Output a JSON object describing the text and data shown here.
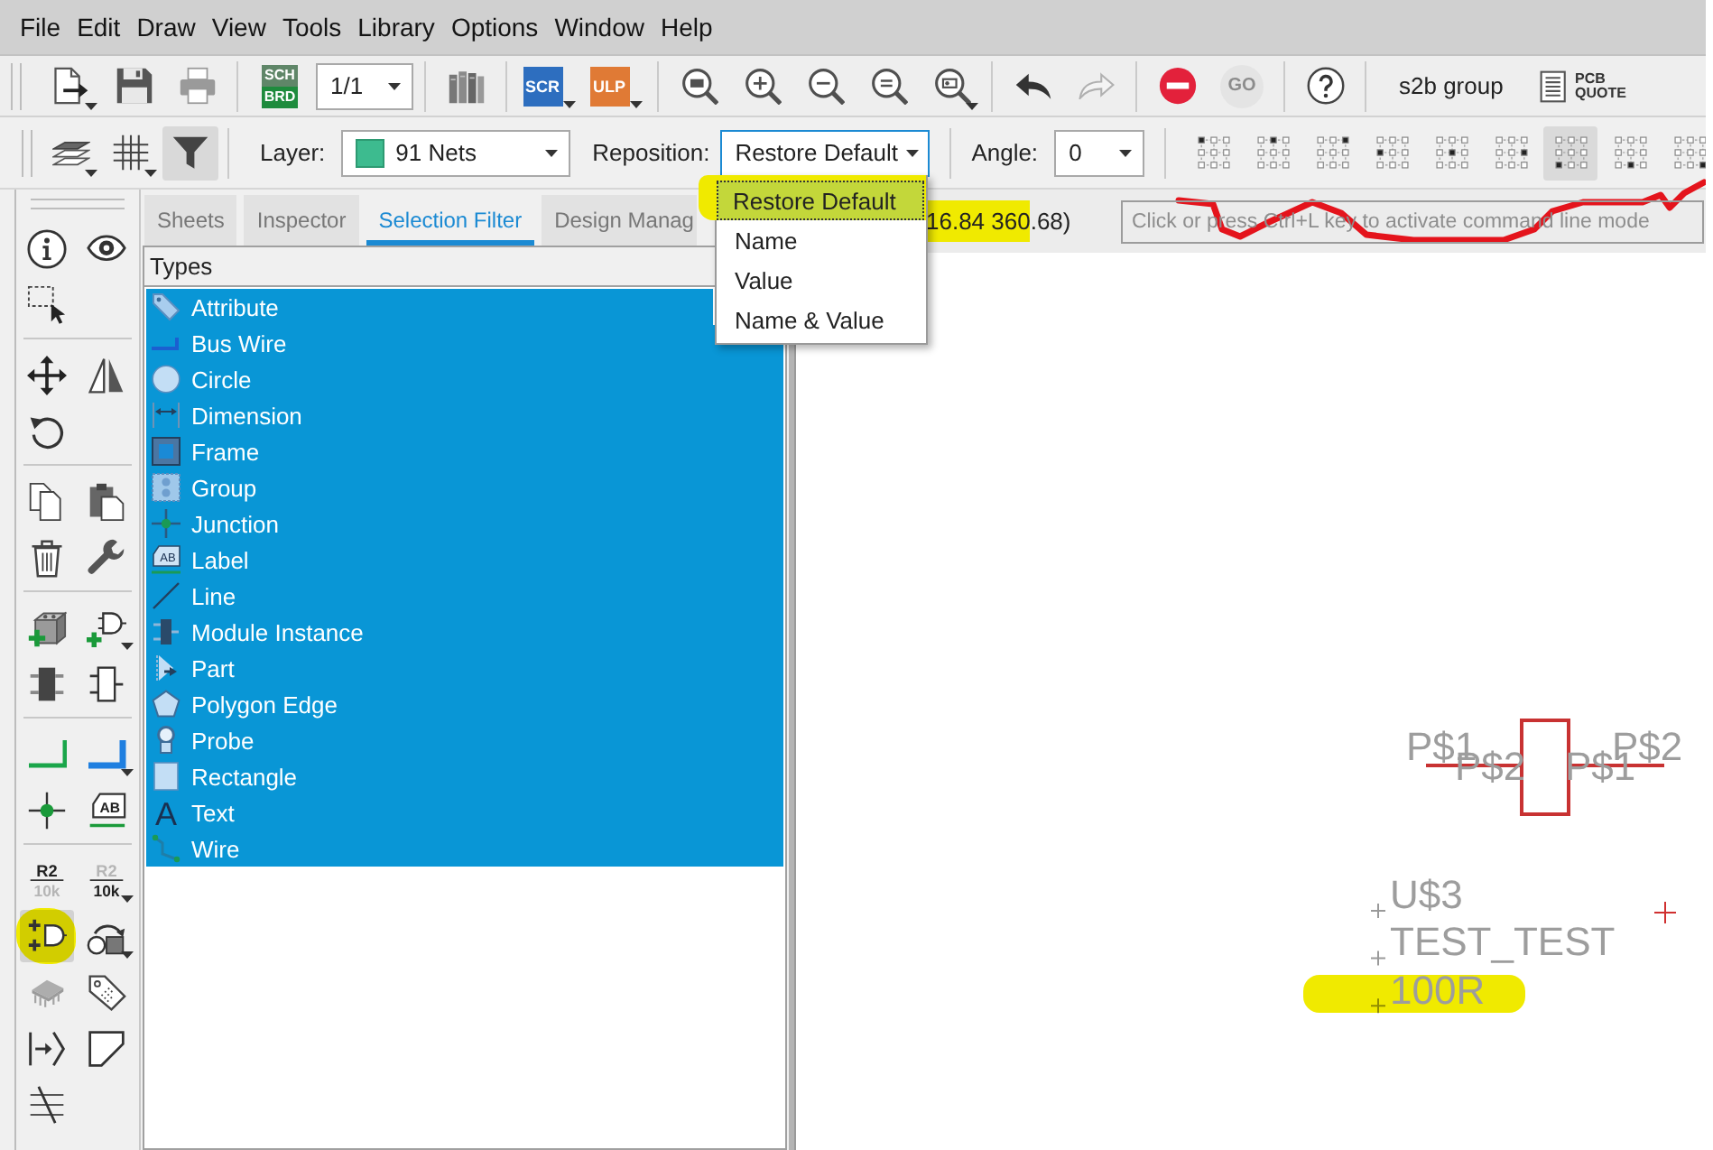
{
  "menu_bar": [
    "File",
    "Edit",
    "Draw",
    "View",
    "Tools",
    "Library",
    "Options",
    "Window",
    "Help"
  ],
  "main_toolbar": [
    [
      {
        "kind": "open-file",
        "disabled": false,
        "dropdown": true
      },
      {
        "kind": "save",
        "disabled": false,
        "dropdown": false
      },
      {
        "kind": "print",
        "disabled": false,
        "dropdown": false
      }
    ],
    [
      {
        "kind": "sch-brd",
        "labels": [
          "SCH",
          "BRD"
        ],
        "disabled": false,
        "dropdown": false
      },
      {
        "kind": "sheet-combo",
        "value": "1/1"
      }
    ],
    [
      {
        "kind": "library",
        "disabled": false,
        "dropdown": false
      }
    ],
    [
      {
        "kind": "script",
        "labels": [
          "SCR"
        ],
        "disabled": false,
        "dropdown": true
      },
      {
        "kind": "ulp",
        "labels": [
          "ULP"
        ],
        "disabled": false,
        "dropdown": true
      }
    ],
    [
      {
        "kind": "zoom-fit",
        "disabled": false,
        "dropdown": false
      },
      {
        "kind": "zoom-in",
        "disabled": false,
        "dropdown": false
      },
      {
        "kind": "zoom-out",
        "disabled": false,
        "dropdown": false
      },
      {
        "kind": "zoom-redraw",
        "disabled": false,
        "dropdown": false
      },
      {
        "kind": "zoom-area",
        "disabled": false,
        "dropdown": true
      }
    ],
    [
      {
        "kind": "undo",
        "disabled": false,
        "dropdown": false
      },
      {
        "kind": "redo",
        "disabled": true,
        "dropdown": false
      }
    ],
    [
      {
        "kind": "stop",
        "disabled": false,
        "dropdown": false
      },
      {
        "kind": "go",
        "labels": [
          "GO"
        ],
        "disabled": true,
        "dropdown": false
      }
    ],
    [
      {
        "kind": "help",
        "disabled": false,
        "dropdown": false
      }
    ],
    [
      {
        "kind": "team",
        "text": "s2b group"
      },
      {
        "kind": "pcb-quote",
        "labels": [
          "PCB",
          "QUOTE"
        ],
        "disabled": false,
        "dropdown": false
      }
    ]
  ],
  "edit_toolbar": {
    "tools": [
      {
        "kind": "layers",
        "selected": false,
        "dropdown": true
      },
      {
        "kind": "grid",
        "selected": false,
        "dropdown": true
      },
      {
        "kind": "filter",
        "selected": true,
        "dropdown": false
      }
    ],
    "layer": {
      "label": "Layer:",
      "value": "91 Nets"
    },
    "reposition": {
      "label": "Reposition:",
      "value": "Restore Default",
      "expanded": true,
      "options": [
        {
          "text": "Restore Default",
          "selected": true,
          "highlighted": true
        },
        {
          "text": "Name",
          "selected": false,
          "highlighted": false
        },
        {
          "text": "Value",
          "selected": false,
          "highlighted": false
        },
        {
          "text": "Name & Value",
          "selected": false,
          "highlighted": false
        }
      ]
    },
    "angle": {
      "label": "Angle:",
      "value": "0"
    },
    "anchors": [
      {
        "kind": "top-left",
        "selected": false
      },
      {
        "kind": "top-center",
        "selected": false
      },
      {
        "kind": "top-right",
        "selected": false
      },
      {
        "kind": "middle-left",
        "selected": false
      },
      {
        "kind": "center",
        "selected": false
      },
      {
        "kind": "middle-right",
        "selected": false
      },
      {
        "kind": "bottom-left",
        "selected": true
      },
      {
        "kind": "bottom-center",
        "selected": false
      },
      {
        "kind": "bottom-right",
        "selected": false
      }
    ]
  },
  "tool_palette": [
    [
      {
        "kind": "info",
        "selected": false,
        "disabled": false,
        "dropdown": false,
        "highlighted": false
      },
      {
        "kind": "show",
        "selected": false,
        "disabled": false,
        "dropdown": false,
        "highlighted": false
      },
      {
        "kind": "group",
        "selected": false,
        "disabled": false,
        "dropdown": false,
        "highlighted": false
      }
    ],
    [
      {
        "kind": "move",
        "selected": false,
        "disabled": false,
        "dropdown": false,
        "highlighted": false
      },
      {
        "kind": "mirror",
        "selected": false,
        "disabled": false,
        "dropdown": false,
        "highlighted": false
      },
      {
        "kind": "rotate",
        "selected": false,
        "disabled": false,
        "dropdown": false,
        "highlighted": false
      }
    ],
    [
      {
        "kind": "copy",
        "selected": false,
        "disabled": false,
        "dropdown": false,
        "highlighted": false
      },
      {
        "kind": "paste",
        "selected": false,
        "disabled": false,
        "dropdown": false,
        "highlighted": false
      },
      {
        "kind": "delete",
        "selected": false,
        "disabled": false,
        "dropdown": false,
        "highlighted": false
      },
      {
        "kind": "change",
        "selected": false,
        "disabled": false,
        "dropdown": false,
        "highlighted": false
      }
    ],
    [
      {
        "kind": "add-part",
        "selected": false,
        "disabled": false,
        "dropdown": false,
        "highlighted": false
      },
      {
        "kind": "add-gate",
        "selected": false,
        "disabled": false,
        "dropdown": true,
        "highlighted": false
      },
      {
        "kind": "module",
        "selected": false,
        "disabled": false,
        "dropdown": false,
        "highlighted": false
      },
      {
        "kind": "port",
        "selected": false,
        "disabled": false,
        "dropdown": false,
        "highlighted": false
      }
    ],
    [
      {
        "kind": "net",
        "selected": false,
        "disabled": false,
        "dropdown": false,
        "highlighted": false
      },
      {
        "kind": "bus",
        "selected": false,
        "disabled": false,
        "dropdown": true,
        "highlighted": false
      },
      {
        "kind": "junction",
        "selected": false,
        "disabled": false,
        "dropdown": false,
        "highlighted": false
      },
      {
        "kind": "label",
        "labels": [
          "AB"
        ],
        "selected": false,
        "disabled": false,
        "dropdown": false,
        "highlighted": false
      }
    ],
    [
      {
        "kind": "name",
        "labels": [
          "R2",
          "10k"
        ],
        "selected": false,
        "disabled": false,
        "dropdown": false,
        "highlighted": false
      },
      {
        "kind": "value",
        "labels": [
          "R2",
          "10k"
        ],
        "selected": false,
        "disabled": false,
        "dropdown": true,
        "highlighted": false
      },
      {
        "kind": "invoke",
        "selected": true,
        "disabled": false,
        "dropdown": false,
        "highlighted": true
      },
      {
        "kind": "replace",
        "selected": false,
        "disabled": false,
        "dropdown": true,
        "highlighted": false
      },
      {
        "kind": "package",
        "selected": false,
        "disabled": true,
        "dropdown": false,
        "highlighted": false
      },
      {
        "kind": "attribute",
        "selected": false,
        "disabled": false,
        "dropdown": false,
        "highlighted": false
      },
      {
        "kind": "pin-arrow",
        "selected": false,
        "disabled": false,
        "dropdown": false,
        "highlighted": false
      },
      {
        "kind": "miter",
        "selected": false,
        "disabled": false,
        "dropdown": false,
        "highlighted": false
      },
      {
        "kind": "split",
        "selected": false,
        "disabled": false,
        "dropdown": false,
        "highlighted": false
      }
    ]
  ],
  "side_panel": {
    "tabs": [
      {
        "label": "Sheets",
        "selected": false
      },
      {
        "label": "Inspector",
        "selected": false
      },
      {
        "label": "Selection Filter",
        "selected": true
      },
      {
        "label": "Design Manag",
        "selected": false
      }
    ],
    "header": "Types",
    "items": [
      {
        "kind": "attribute",
        "label": "Attribute",
        "selected": true
      },
      {
        "kind": "bus-wire",
        "label": "Bus Wire",
        "selected": true
      },
      {
        "kind": "circle",
        "label": "Circle",
        "selected": true
      },
      {
        "kind": "dimension",
        "label": "Dimension",
        "selected": true
      },
      {
        "kind": "frame",
        "label": "Frame",
        "selected": true
      },
      {
        "kind": "group",
        "label": "Group",
        "selected": true
      },
      {
        "kind": "junction",
        "label": "Junction",
        "selected": true
      },
      {
        "kind": "label",
        "label": "Label",
        "icon_label": "AB",
        "selected": true
      },
      {
        "kind": "line",
        "label": "Line",
        "selected": true
      },
      {
        "kind": "module-instance",
        "label": "Module Instance",
        "selected": true
      },
      {
        "kind": "part",
        "label": "Part",
        "selected": true
      },
      {
        "kind": "polygon-edge",
        "label": "Polygon Edge",
        "selected": true
      },
      {
        "kind": "probe",
        "label": "Probe",
        "selected": true
      },
      {
        "kind": "rectangle",
        "label": "Rectangle",
        "selected": true
      },
      {
        "kind": "text",
        "label": "Text",
        "icon_label": "A",
        "selected": true
      },
      {
        "kind": "wire",
        "label": "Wire",
        "selected": true
      }
    ]
  },
  "status": {
    "coordinates": {
      "text": "16.84 360.68)",
      "highlighted": true
    },
    "command_line": {
      "placeholder": "Click or press Ctrl+L key to activate command line mode"
    }
  },
  "schematic": {
    "pins": [
      {
        "labels": [
          "P$1",
          "P$2"
        ]
      },
      {
        "labels": [
          "P$1",
          "P$2"
        ]
      }
    ],
    "texts": [
      {
        "text": "U$3",
        "highlighted": false
      },
      {
        "text": "TEST_TEST",
        "highlighted": false
      },
      {
        "text": "100R",
        "highlighted": true
      }
    ]
  }
}
